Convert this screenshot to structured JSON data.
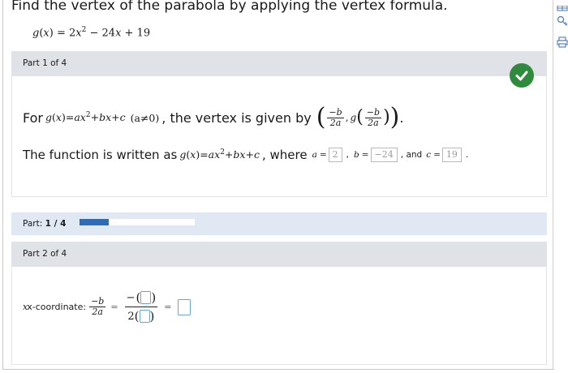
{
  "question": "Find the vertex of the parabola by applying the vertex formula.",
  "given": {
    "lhs": "g",
    "var": "x",
    "rhs_a": "2",
    "rhs_b": "24",
    "rhs_c": "19",
    "exp": "2"
  },
  "part1": {
    "header": "Part 1 of 4",
    "status": "correct",
    "line1_prefix": "For",
    "line1_mid": ", the vertex is given by",
    "line2_prefix": "The function is written as",
    "line2_where": ", where",
    "line2_and": ", and",
    "a_value": "2",
    "b_value": "−24",
    "c_value": "19",
    "cond": "(a≠0)"
  },
  "progress": {
    "label": "Part:",
    "current": "1 / 4",
    "fraction": 0.25
  },
  "part2": {
    "header": "Part 2 of 4",
    "xcoord_label": "x-coordinate:",
    "two": "2"
  },
  "colors": {
    "check_green": "#2e8b3c",
    "progress_fill": "#2e6cb5",
    "header_gray": "#dfe2e6"
  },
  "side_icons": [
    "table-icon",
    "key-icon",
    "print-icon"
  ]
}
